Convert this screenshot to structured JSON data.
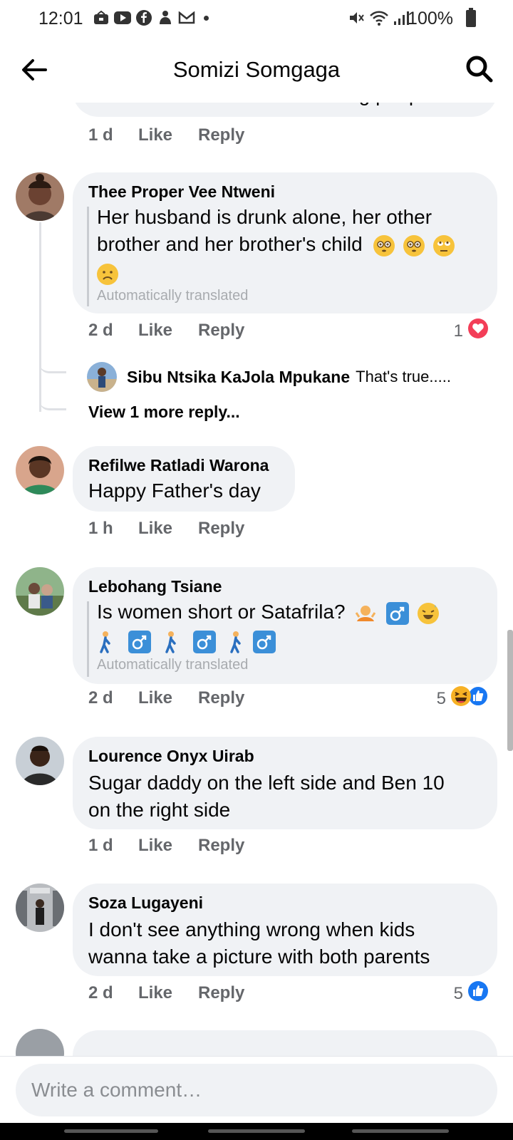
{
  "status_bar": {
    "time": "12:01",
    "battery": "100%",
    "icons_left": [
      "mail-icon",
      "youtube-icon",
      "facebook-icon",
      "notification-icon",
      "gmail-icon"
    ],
    "icons_right": [
      "mute-icon",
      "wifi-icon",
      "signal-icon",
      "battery-icon"
    ]
  },
  "header": {
    "title": "Somizi Somgaga"
  },
  "top_partial": {
    "text": "relatives...... You are misleading people",
    "time": "1 d",
    "like": "Like",
    "reply": "Reply"
  },
  "comments": [
    {
      "author": "Thee Proper Vee Ntweni",
      "text_line1": "Her husband is drunk alone, her other",
      "text_line2": "brother and her brother's child",
      "translated": "Automatically translated",
      "time": "2 d",
      "like": "Like",
      "reply": "Reply",
      "reaction_count": "1",
      "reaction_icons": [
        "love-icon"
      ],
      "replies": [
        {
          "author": "Sibu Ntsika KaJola Mpukane",
          "text": "That's true....."
        }
      ],
      "view_more": "View 1 more reply..."
    },
    {
      "author": "Refilwe Ratladi Warona",
      "text": "Happy Father's day",
      "time": "1 h",
      "like": "Like",
      "reply": "Reply"
    },
    {
      "author": "Lebohang Tsiane",
      "text_line1": "Is women short or Satafrila?",
      "translated": "Automatically translated",
      "time": "2 d",
      "like": "Like",
      "reply": "Reply",
      "reaction_count": "5",
      "reaction_icons": [
        "haha-icon",
        "like-icon"
      ]
    },
    {
      "author": "Lourence Onyx Uirab",
      "text_line1": "Sugar daddy on the left side and Ben 10",
      "text_line2": "on the right side",
      "time": "1 d",
      "like": "Like",
      "reply": "Reply"
    },
    {
      "author": "Soza Lugayeni",
      "text_line1": "I don't see anything wrong when kids",
      "text_line2": "wanna take a picture with both parents",
      "time": "2 d",
      "like": "Like",
      "reply": "Reply",
      "reaction_count": "5",
      "reaction_icons": [
        "like-icon"
      ]
    }
  ],
  "composer": {
    "placeholder": "Write a comment…"
  },
  "colors": {
    "bubble": "#f0f2f5",
    "meta_text": "#65676b",
    "like_blue": "#1877f2",
    "love_red": "#f33e58",
    "haha_yellow": "#f7b125"
  }
}
